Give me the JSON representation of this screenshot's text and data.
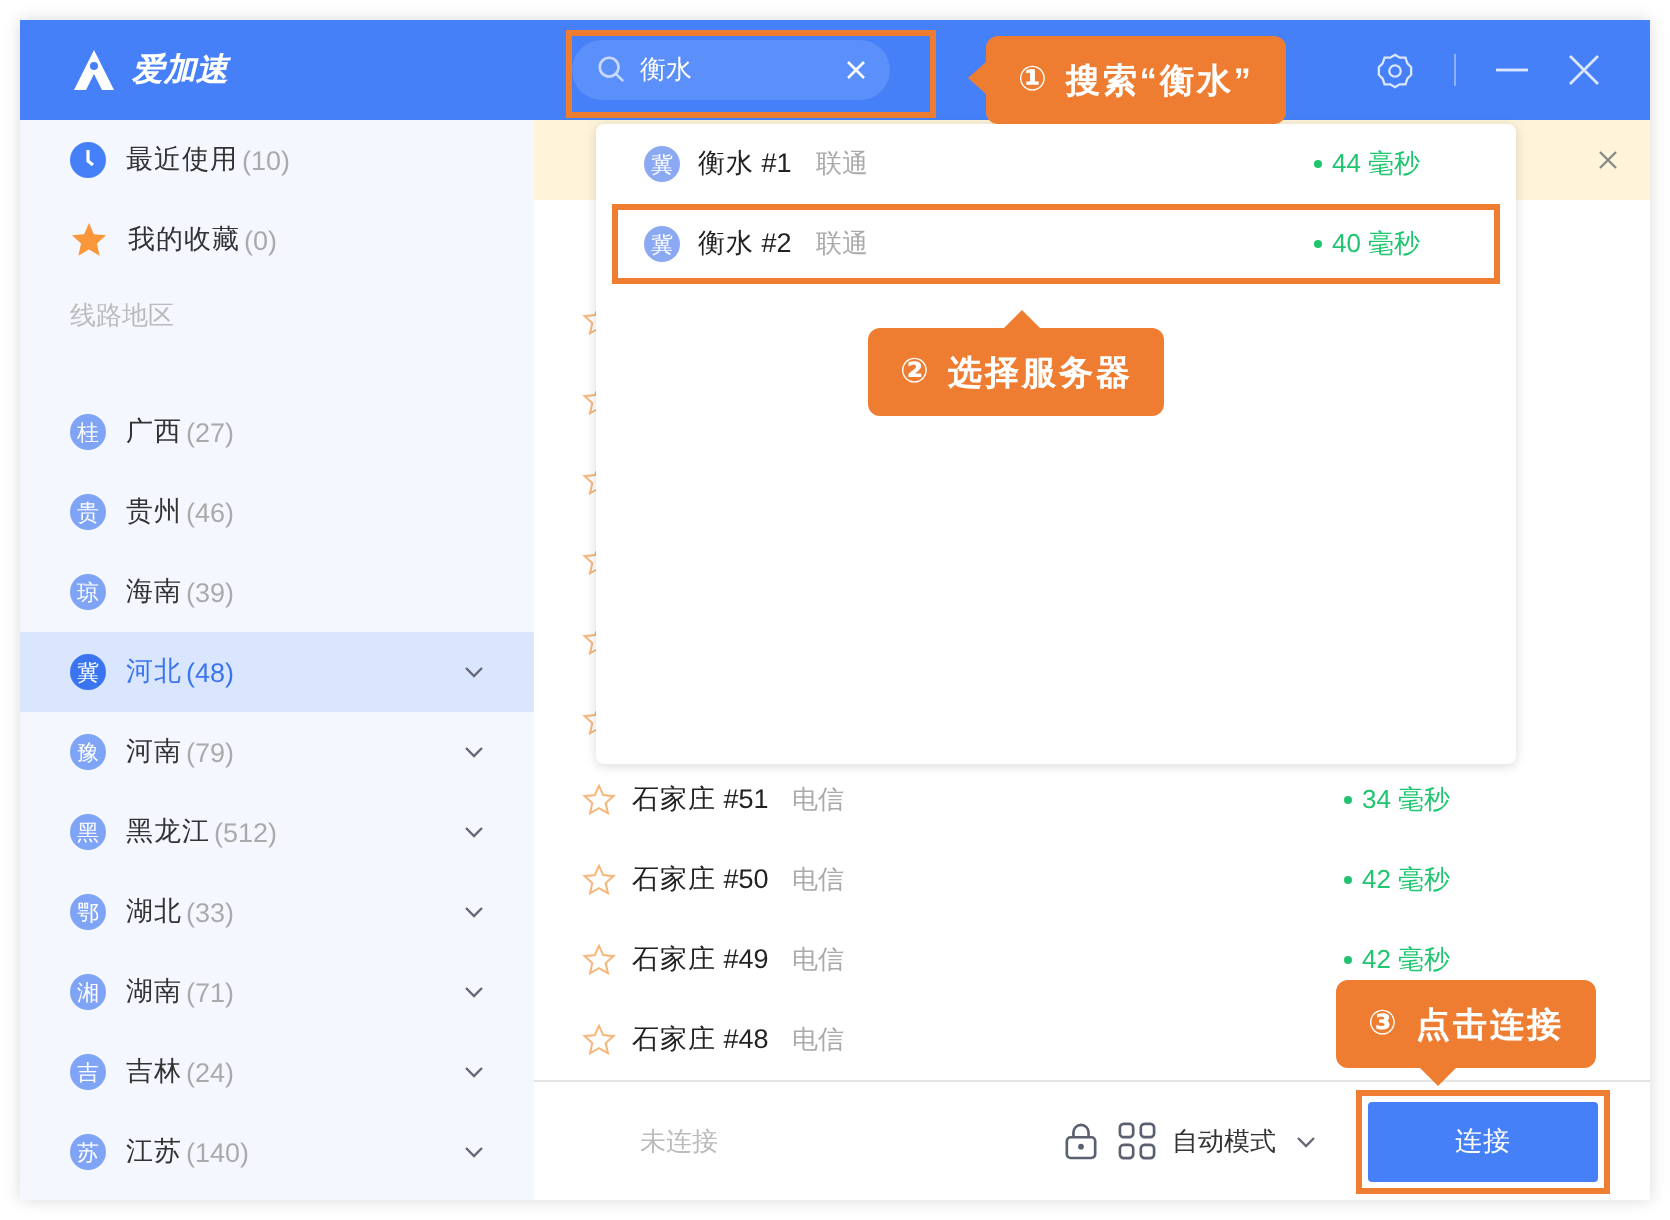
{
  "app": {
    "name": "爱加速"
  },
  "search": {
    "value": "衡水",
    "highlighted": true
  },
  "sidebar": {
    "shortcuts": [
      {
        "kind": "recent",
        "label": "最近使用",
        "count": "(10)"
      },
      {
        "kind": "favorites",
        "label": "我的收藏",
        "count": "(0)"
      }
    ],
    "section_label": "线路地区",
    "regions": [
      {
        "badge": "桂",
        "name": "广西",
        "count": "(27)",
        "expandable": false,
        "selected": false
      },
      {
        "badge": "贵",
        "name": "贵州",
        "count": "(46)",
        "expandable": false,
        "selected": false
      },
      {
        "badge": "琼",
        "name": "海南",
        "count": "(39)",
        "expandable": false,
        "selected": false
      },
      {
        "badge": "冀",
        "name": "河北",
        "count": "(48)",
        "expandable": true,
        "selected": true
      },
      {
        "badge": "豫",
        "name": "河南",
        "count": "(79)",
        "expandable": true,
        "selected": false
      },
      {
        "badge": "黑",
        "name": "黑龙江",
        "count": "(512)",
        "expandable": true,
        "selected": false
      },
      {
        "badge": "鄂",
        "name": "湖北",
        "count": "(33)",
        "expandable": true,
        "selected": false
      },
      {
        "badge": "湘",
        "name": "湖南",
        "count": "(71)",
        "expandable": true,
        "selected": false
      },
      {
        "badge": "吉",
        "name": "吉林",
        "count": "(24)",
        "expandable": true,
        "selected": false
      },
      {
        "badge": "苏",
        "name": "江苏",
        "count": "(140)",
        "expandable": true,
        "selected": false
      }
    ]
  },
  "server_list": {
    "rows": [
      {
        "kind": "covered"
      },
      {
        "kind": "covered"
      },
      {
        "kind": "covered"
      },
      {
        "kind": "covered"
      },
      {
        "kind": "covered"
      },
      {
        "kind": "covered"
      },
      {
        "kind": "server",
        "name": "石家庄 #51",
        "isp": "电信",
        "latency": "34 毫秒"
      },
      {
        "kind": "server",
        "name": "石家庄 #50",
        "isp": "电信",
        "latency": "42 毫秒"
      },
      {
        "kind": "server",
        "name": "石家庄 #49",
        "isp": "电信",
        "latency": "42 毫秒"
      },
      {
        "kind": "server",
        "name": "石家庄 #48",
        "isp": "电信"
      }
    ]
  },
  "search_results": [
    {
      "badge": "冀",
      "name": "衡水 #1",
      "isp": "联通",
      "latency": "44 毫秒",
      "highlighted": false
    },
    {
      "badge": "冀",
      "name": "衡水 #2",
      "isp": "联通",
      "latency": "40 毫秒",
      "highlighted": true
    }
  ],
  "footer": {
    "status": "未连接",
    "mode": "自动模式",
    "connect_button": {
      "label": "连接",
      "highlighted": true
    }
  },
  "callouts": [
    {
      "number": "①",
      "text": "搜索“衡水”"
    },
    {
      "number": "②",
      "text": "选择服务器"
    },
    {
      "number": "③",
      "text": "点击连接"
    }
  ]
}
